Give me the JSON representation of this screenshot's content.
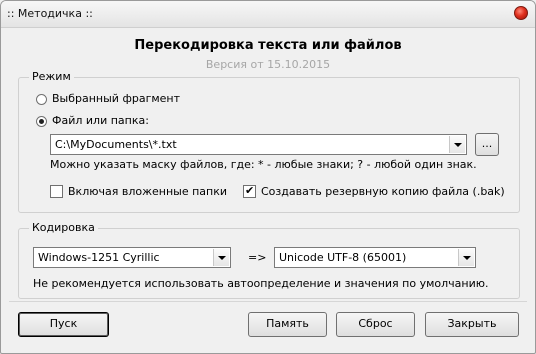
{
  "window": {
    "title": ":: Методичка ::"
  },
  "header": {
    "title": "Перекодировка текста или файлов",
    "version": "Версия от 15.10.2015"
  },
  "mode": {
    "legend": "Режим",
    "option_fragment": "Выбранный фрагмент",
    "option_file": "Файл или папка:",
    "selected": "file",
    "path_value": "C:\\MyDocuments\\*.txt",
    "browse_label": "...",
    "hint": "Можно указать маску файлов, где: * - любые знаки; ? - любой один знак.",
    "include_subfolders_label": "Включая вложенные папки",
    "include_subfolders_checked": false,
    "backup_label": "Создавать резервную копию файла (.bak)",
    "backup_checked": true
  },
  "encoding": {
    "legend": "Кодировка",
    "source": "Windows-1251 Cyrillic",
    "arrow": "=>",
    "target": "Unicode UTF-8 (65001)",
    "note": "Не рекомендуется использовать автоопределение и значения по умолчанию."
  },
  "buttons": {
    "start": "Пуск",
    "memory": "Память",
    "reset": "Сброс",
    "close": "Закрыть"
  }
}
